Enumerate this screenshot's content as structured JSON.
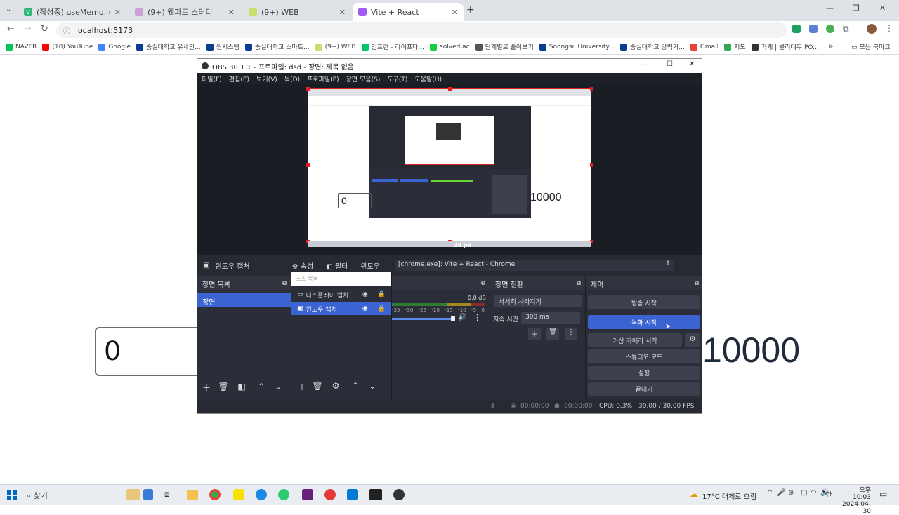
{
  "browser": {
    "tabs": [
      {
        "title": "(작성중) useMemo, useCallba",
        "favicon_color": "#2eb67d",
        "favicon_letter": "V",
        "active": false
      },
      {
        "title": "(9+) 웹파트 스터디",
        "favicon_color": "#c9a3d6",
        "favicon_letter": "",
        "active": false
      },
      {
        "title": "(9+) WEB",
        "favicon_color": "#c8e06b",
        "favicon_letter": "",
        "active": false
      },
      {
        "title": "Vite + React",
        "favicon_color": "#a05cf5",
        "favicon_letter": "",
        "active": true
      }
    ],
    "new_tab_label": "+",
    "url": "localhost:5173",
    "bookmarks": [
      {
        "label": "NAVER",
        "color": "#03c75a"
      },
      {
        "label": "(10) YouTube",
        "color": "#ff0000"
      },
      {
        "label": "Google",
        "color": "#4285f4"
      },
      {
        "label": "숭실대학교 유세인...",
        "color": "#0a3d91"
      },
      {
        "label": "씬시스템",
        "color": "#0a3d91"
      },
      {
        "label": "숭실대학교 스마트...",
        "color": "#0a3d91"
      },
      {
        "label": "(9+) WEB",
        "color": "#c8e06b"
      },
      {
        "label": "인프런 - 라이프타...",
        "color": "#00c471"
      },
      {
        "label": "solved.ac",
        "color": "#17ce3a"
      },
      {
        "label": "단계별로 풀어보기",
        "color": "#555555"
      },
      {
        "label": "Soongsil University...",
        "color": "#0a3d91"
      },
      {
        "label": "숭실대학교 강력가...",
        "color": "#0a3d91"
      },
      {
        "label": "Gmail",
        "color": "#ea4335"
      },
      {
        "label": "지도",
        "color": "#34a853"
      },
      {
        "label": "가게 | 클리데두 PO...",
        "color": "#333333"
      }
    ],
    "more_bookmarks": "»",
    "all_bookmarks": "모든 북마크"
  },
  "page": {
    "input_value": "0",
    "number": "10000"
  },
  "obs": {
    "title": "OBS 30.1.1 - 프로파일: dsd - 장면: 제목 없음",
    "menu": [
      "파일(F)",
      "편집(E)",
      "보기(V)",
      "독(D)",
      "프로파일(P)",
      "장면 모음(S)",
      "도구(T)",
      "도움말(H)"
    ],
    "preview": {
      "inner_input": "0",
      "inner_number": "10000",
      "size_label": "39 px"
    },
    "source_bar": {
      "source_name": "윈도우 캡처",
      "properties": "속성",
      "filters": "필터",
      "window_label": "윈도우",
      "window_value": "[chrome.exe]: Vite + React - Chrome"
    },
    "scenes": {
      "header": "장면 목록",
      "items": [
        "장면"
      ]
    },
    "sources": {
      "header": "소스 목록",
      "items": [
        "디스플레이 캡처",
        "윈도우 캡처"
      ]
    },
    "mixer": {
      "db": "0.0 dB",
      "ticks": [
        "-35",
        "-30",
        "-25",
        "-20",
        "-15",
        "-10",
        "-5",
        "0"
      ]
    },
    "transitions": {
      "header": "장면 전환",
      "type": "서서히 사라지기",
      "duration_label": "지속 시간",
      "duration_value": "300 ms"
    },
    "controls": {
      "header": "제어",
      "buttons": [
        "방송 시작",
        "녹화 시작",
        "가상 카메라 시작",
        "스튜디오 모드",
        "설정",
        "끝내기"
      ]
    },
    "status": {
      "live_time": "00:00:00",
      "rec_time": "00:00:00",
      "cpu": "CPU: 0.3%",
      "fps": "30.00 / 30.00 FPS"
    }
  },
  "taskbar": {
    "search": "찾기",
    "weather": "17°C 대체로 흐림",
    "time": "오후 10:03",
    "date": "2024-04-30",
    "lang": "한"
  }
}
